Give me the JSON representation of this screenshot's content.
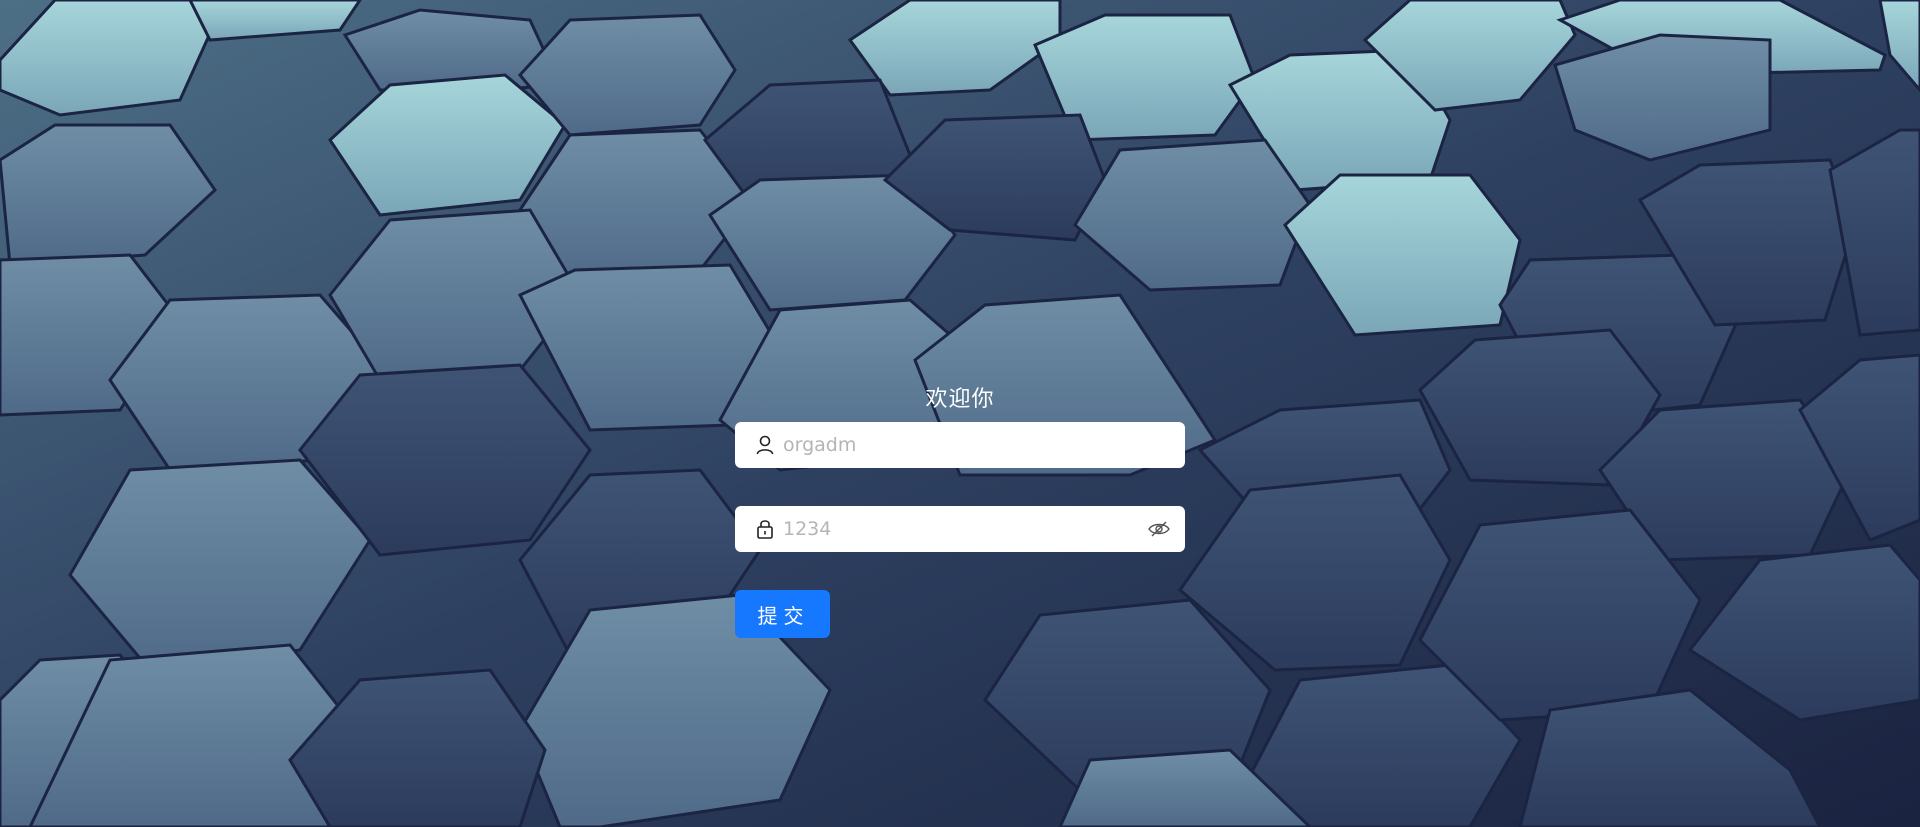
{
  "login": {
    "title": "欢迎你",
    "username": {
      "placeholder": "orgadm",
      "value": "",
      "icon": "user-icon"
    },
    "password": {
      "placeholder": "1234",
      "value": "",
      "icon": "lock-icon",
      "toggle_icon": "eye-invisible-icon"
    },
    "submit_label": "提交"
  },
  "colors": {
    "primary": "#1677ff",
    "input_bg": "#ffffff",
    "title_text": "#ffffff",
    "hex_light": "#8fc4cf",
    "hex_dark": "#1f2a48"
  }
}
